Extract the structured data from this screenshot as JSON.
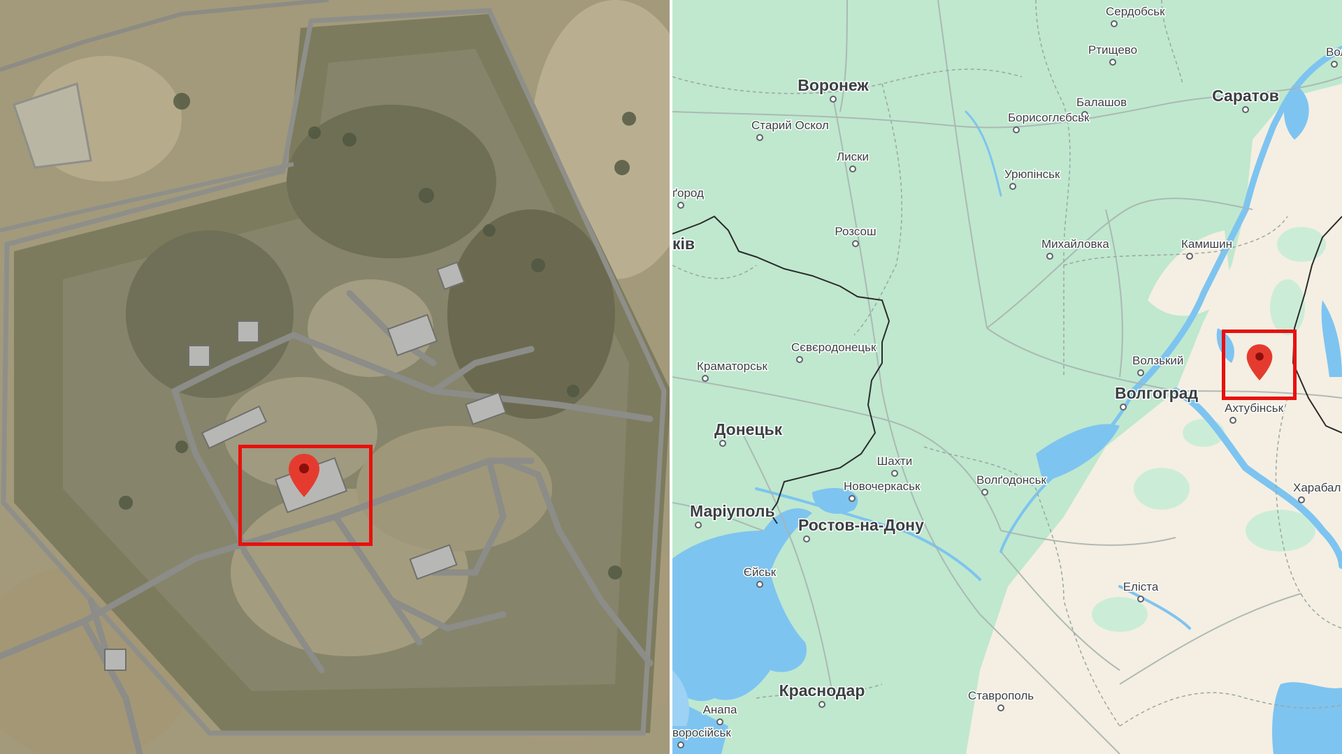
{
  "colors": {
    "highlight": "#e8100e",
    "marker": "#e53b2f",
    "marker_dot": "#8b0f0a",
    "water": "#7ec4f0",
    "land_green": "#bfe8cf",
    "land_beige": "#f4efe2",
    "border": "#2b2b2b"
  },
  "satellite": {
    "marker_icon": "map-pin-icon"
  },
  "map": {
    "marker_icon": "map-pin-icon",
    "cities": [
      {
        "id": "serdobsk",
        "name": "Сердобськ",
        "size": "sm"
      },
      {
        "id": "rtyshchevo",
        "name": "Ртищево",
        "size": "sm"
      },
      {
        "id": "volsk",
        "name": "Вольсь",
        "size": "sm"
      },
      {
        "id": "voronezh",
        "name": "Воронеж",
        "size": "big"
      },
      {
        "id": "saratov",
        "name": "Саратов",
        "size": "big"
      },
      {
        "id": "balashov",
        "name": "Балашов",
        "size": "sm"
      },
      {
        "id": "borysohlibsk",
        "name": "Борисоглєбськ",
        "size": "sm"
      },
      {
        "id": "staryi-oskol",
        "name": "Старий Оскол",
        "size": "sm"
      },
      {
        "id": "lysky",
        "name": "Лиски",
        "size": "sm"
      },
      {
        "id": "uriupinsk",
        "name": "Урюпінськ",
        "size": "sm"
      },
      {
        "id": "bilhorod",
        "name": "ґород",
        "size": "sm"
      },
      {
        "id": "rossosh",
        "name": "Розсош",
        "size": "sm"
      },
      {
        "id": "mykhailovka",
        "name": "Михайловка",
        "size": "sm"
      },
      {
        "id": "kamyshyn",
        "name": "Камишин",
        "size": "sm"
      },
      {
        "id": "kharkiv",
        "name": "ків",
        "size": "big"
      },
      {
        "id": "sievierodonetsk",
        "name": "Сєвєродонецьк",
        "size": "sm"
      },
      {
        "id": "kramatorsk",
        "name": "Краматорськ",
        "size": "sm"
      },
      {
        "id": "volzhskyi",
        "name": "Волзький",
        "size": "sm"
      },
      {
        "id": "volgograd",
        "name": "Волгоград",
        "size": "big"
      },
      {
        "id": "akhtubinsk",
        "name": "Ахтубінськ",
        "size": "sm"
      },
      {
        "id": "donetsk",
        "name": "Донецьк",
        "size": "big"
      },
      {
        "id": "shakhty",
        "name": "Шахти",
        "size": "sm"
      },
      {
        "id": "novocherkassk",
        "name": "Новочеркаськ",
        "size": "sm"
      },
      {
        "id": "volgodonsk",
        "name": "Волґодонськ",
        "size": "sm"
      },
      {
        "id": "kharabali",
        "name": "Харабал",
        "size": "sm"
      },
      {
        "id": "mariupol",
        "name": "Маріуполь",
        "size": "big"
      },
      {
        "id": "rostov",
        "name": "Ростов-на-Дону",
        "size": "big"
      },
      {
        "id": "yeysk",
        "name": "Єйськ",
        "size": "sm"
      },
      {
        "id": "elista",
        "name": "Еліста",
        "size": "sm"
      },
      {
        "id": "krasnodar",
        "name": "Краснодар",
        "size": "big"
      },
      {
        "id": "stavropol",
        "name": "Ставрополь",
        "size": "sm"
      },
      {
        "id": "anapa",
        "name": "Анапа",
        "size": "sm"
      },
      {
        "id": "novorossiysk",
        "name": "воросійськ",
        "size": "sm"
      }
    ]
  }
}
